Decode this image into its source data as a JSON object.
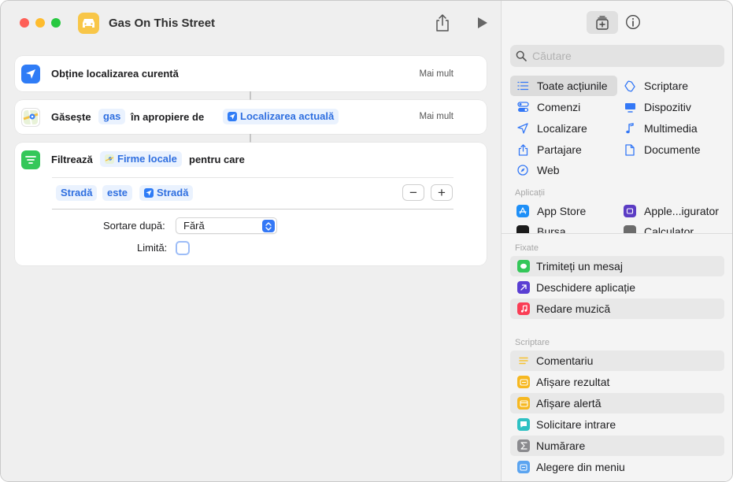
{
  "window": {
    "title": "Gas On This Street"
  },
  "actions": {
    "get_location": {
      "label": "Obține localizarea curentă",
      "more": "Mai mult"
    },
    "find": {
      "label": "Găsește",
      "token_query": "gas",
      "mid_text": "în apropiere de",
      "token_location": "Localizarea actuală",
      "more": "Mai mult"
    },
    "filter": {
      "label": "Filtrează",
      "token_source": "Firme locale",
      "suffix": "pentru care",
      "condition": {
        "field": "Stradă",
        "operator": "este",
        "value": "Stradă"
      },
      "remove_label": "−",
      "add_label": "+",
      "sort_label": "Sortare după:",
      "sort_value": "Fără",
      "limit_label": "Limită:"
    }
  },
  "sidebar": {
    "search_placeholder": "Căutare",
    "categories_left": [
      "Toate acțiunile",
      "Comenzi",
      "Localizare",
      "Partajare",
      "Web"
    ],
    "categories_right": [
      "Scriptare",
      "Dispozitiv",
      "Multimedia",
      "Documente"
    ],
    "apps_header": "Aplicații",
    "apps": [
      "App Store",
      "Apple...igurator",
      "Bursa",
      "Calculator"
    ],
    "pinned_header": "Fixate",
    "pinned": [
      "Trimiteți un mesaj",
      "Deschidere aplicație",
      "Redare muzică"
    ],
    "scripting_header": "Scriptare",
    "scripting": [
      "Comentariu",
      "Afișare rezultat",
      "Afișare alertă",
      "Solicitare intrare",
      "Numărare",
      "Alegere din meniu"
    ]
  },
  "colors": {
    "accent": "#3478f6",
    "token_bg": "#eaf2fe",
    "token_text": "#2f6fe0"
  }
}
